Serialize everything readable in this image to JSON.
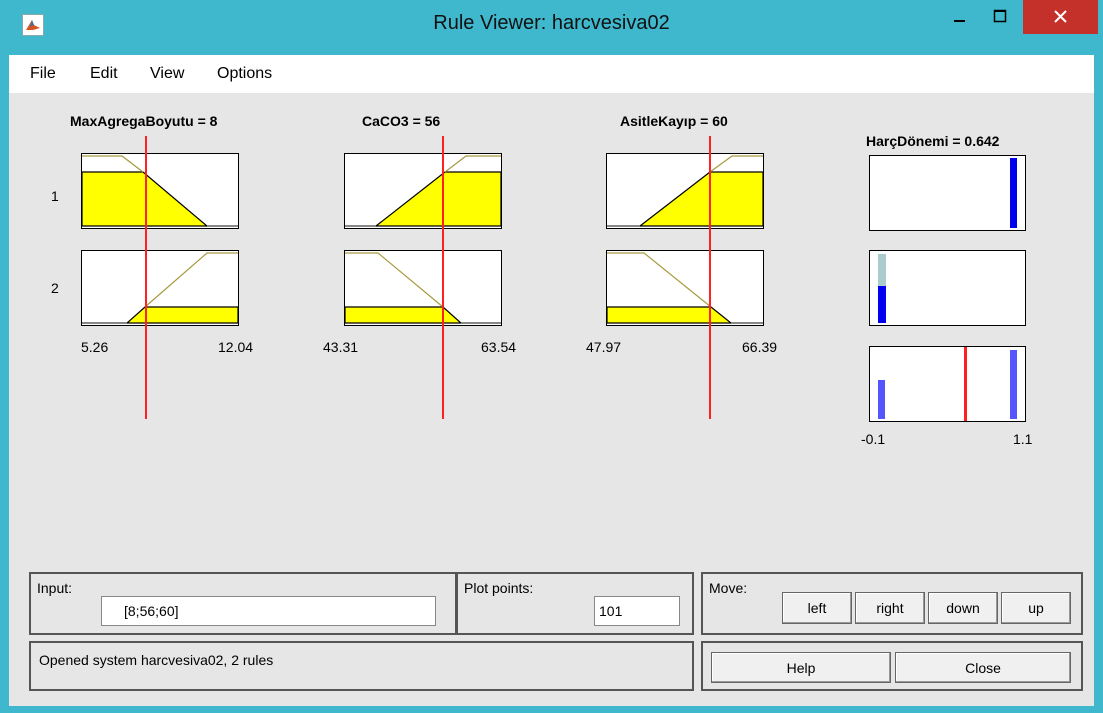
{
  "window": {
    "title": "Rule Viewer: harcvesiva02"
  },
  "menu": [
    "File",
    "Edit",
    "View",
    "Options"
  ],
  "inputs": [
    {
      "label": "MaxAgregaBoyutu = 8",
      "range_min": "5.26",
      "range_max": "12.04"
    },
    {
      "label": "CaCO3 = 56",
      "range_min": "43.31",
      "range_max": "63.54"
    },
    {
      "label": "AsitleKayıp = 60",
      "range_min": "47.97",
      "range_max": "66.39"
    }
  ],
  "output": {
    "label": "HarçDönemi = 0.642",
    "range_min": "-0.1",
    "range_max": "1.1"
  },
  "rules": [
    "1",
    "2"
  ],
  "bottom": {
    "input_label": "Input:",
    "input_value": "[8;56;60]",
    "plot_points_label": "Plot points:",
    "plot_points_value": "101",
    "move_label": "Move:",
    "move_buttons": [
      "left",
      "right",
      "down",
      "up"
    ],
    "status": "Opened system harcvesiva02, 2 rules",
    "help": "Help",
    "close": "Close"
  },
  "colors": {
    "fill": "#ffff00",
    "cursor": "#ff2020",
    "bar": "#0000ee",
    "bar_faint": "#aacccc",
    "titlebar": "#3fb8cd"
  }
}
